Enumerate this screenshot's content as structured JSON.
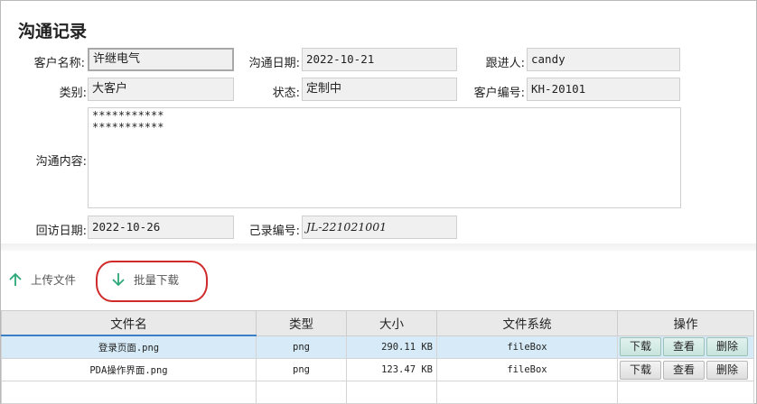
{
  "form": {
    "title": "沟通记录",
    "customer_name": {
      "label": "客户名称:",
      "value": "许继电气"
    },
    "comm_date": {
      "label": "沟通日期:",
      "value": "2022-10-21"
    },
    "follower": {
      "label": "跟进人:",
      "value": "candy"
    },
    "category": {
      "label": "类别:",
      "value": "大客户"
    },
    "status": {
      "label": "状态:",
      "value": "定制中"
    },
    "customer_no": {
      "label": "客户编号:",
      "value": "KH-20101"
    },
    "content": {
      "label": "沟通内容:",
      "value": "***********\n***********"
    },
    "revisit_date": {
      "label": "回访日期:",
      "value": "2022-10-26"
    },
    "record_no": {
      "label": "己录编号:",
      "value": "JL-221021001"
    }
  },
  "toolbar": {
    "upload_label": "上传文件",
    "batch_download_label": "批量下载"
  },
  "table": {
    "columns": [
      "文件名",
      "类型",
      "大小",
      "文件系统",
      "操作"
    ],
    "rows": [
      {
        "name": "登录页面.png",
        "type": "png",
        "size": "290.11 KB",
        "fs": "fileBox"
      },
      {
        "name": "PDA操作界面.png",
        "type": "png",
        "size": "123.47 KB",
        "fs": "fileBox"
      }
    ],
    "actions": {
      "download": "下载",
      "view": "查看",
      "delete": "删除"
    }
  },
  "colors": {
    "selected_row": "#d6ebf7",
    "accent": "#3d7fc7",
    "upload_arrow": "#2aa876",
    "highlight_ring": "#d02a2a"
  }
}
